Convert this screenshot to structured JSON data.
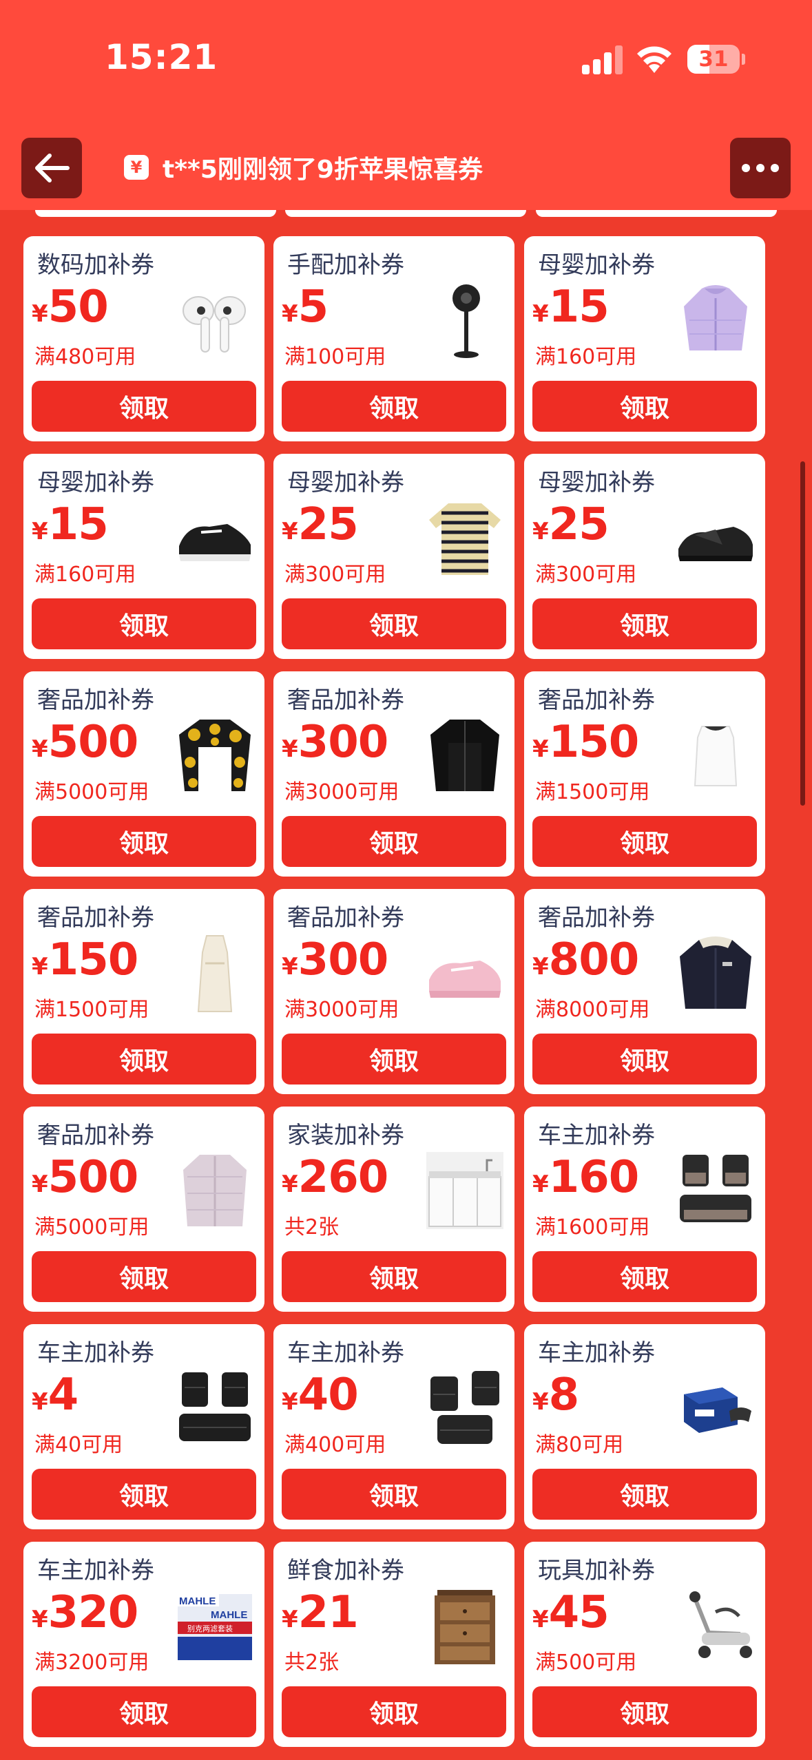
{
  "status_bar": {
    "time": "15:21",
    "battery": "31"
  },
  "header": {
    "notice": "t**5刚刚领了9折苹果惊喜券"
  },
  "coupons": [
    {
      "title": "数码加补券",
      "yen": "¥",
      "amount": "50",
      "condition": "满480可用",
      "button": "领取",
      "image": "airpods-earbuds"
    },
    {
      "title": "手配加补券",
      "yen": "¥",
      "amount": "5",
      "condition": "满100可用",
      "button": "领取",
      "image": "standing-fan"
    },
    {
      "title": "母婴加补券",
      "yen": "¥",
      "amount": "15",
      "condition": "满160可用",
      "button": "领取",
      "image": "lavender-puffer-jacket"
    },
    {
      "title": "母婴加补券",
      "yen": "¥",
      "amount": "15",
      "condition": "满160可用",
      "button": "领取",
      "image": "black-sneaker"
    },
    {
      "title": "母婴加补券",
      "yen": "¥",
      "amount": "25",
      "condition": "满300可用",
      "button": "领取",
      "image": "striped-sweater"
    },
    {
      "title": "母婴加补券",
      "yen": "¥",
      "amount": "25",
      "condition": "满300可用",
      "button": "领取",
      "image": "black-sandal"
    },
    {
      "title": "奢品加补券",
      "yen": "¥",
      "amount": "500",
      "condition": "满5000可用",
      "button": "领取",
      "image": "baroque-print-shirt"
    },
    {
      "title": "奢品加补券",
      "yen": "¥",
      "amount": "300",
      "condition": "满3000可用",
      "button": "领取",
      "image": "black-cardigan"
    },
    {
      "title": "奢品加补券",
      "yen": "¥",
      "amount": "150",
      "condition": "满1500可用",
      "button": "领取",
      "image": "white-top"
    },
    {
      "title": "奢品加补券",
      "yen": "¥",
      "amount": "150",
      "condition": "满1500可用",
      "button": "领取",
      "image": "cream-long-dress"
    },
    {
      "title": "奢品加补券",
      "yen": "¥",
      "amount": "300",
      "condition": "满3000可用",
      "button": "领取",
      "image": "pink-sneaker"
    },
    {
      "title": "奢品加补券",
      "yen": "¥",
      "amount": "800",
      "condition": "满8000可用",
      "button": "领取",
      "image": "navy-down-jacket"
    },
    {
      "title": "奢品加补券",
      "yen": "¥",
      "amount": "500",
      "condition": "满5000可用",
      "button": "领取",
      "image": "lilac-knit-jacket"
    },
    {
      "title": "家装加补券",
      "yen": "¥",
      "amount": "260",
      "condition": "共2张",
      "button": "领取",
      "image": "sink-cabinet"
    },
    {
      "title": "车主加补券",
      "yen": "¥",
      "amount": "160",
      "condition": "满1600可用",
      "button": "领取",
      "image": "car-floor-mats"
    },
    {
      "title": "车主加补券",
      "yen": "¥",
      "amount": "4",
      "condition": "满40可用",
      "button": "领取",
      "image": "car-floor-mats-black"
    },
    {
      "title": "车主加补券",
      "yen": "¥",
      "amount": "40",
      "condition": "满400可用",
      "button": "领取",
      "image": "car-floor-mats-set"
    },
    {
      "title": "车主加补券",
      "yen": "¥",
      "amount": "8",
      "condition": "满80可用",
      "button": "领取",
      "image": "brake-pad-box"
    },
    {
      "title": "车主加补券",
      "yen": "¥",
      "amount": "320",
      "condition": "满3200可用",
      "button": "领取",
      "image": "mahle-filter-set",
      "image_text": [
        "MAHLE",
        "MAHLE",
        "别克两滤套装"
      ]
    },
    {
      "title": "鲜食加补券",
      "yen": "¥",
      "amount": "21",
      "condition": "共2张",
      "button": "领取",
      "image": "wooden-food-box"
    },
    {
      "title": "玩具加补券",
      "yen": "¥",
      "amount": "45",
      "condition": "满500可用",
      "button": "领取",
      "image": "baby-walker"
    }
  ],
  "colors": {
    "background": "#ee3b2c",
    "header": "#ff4a3c",
    "accent": "#f0271f",
    "title_text": "#333b5a"
  }
}
